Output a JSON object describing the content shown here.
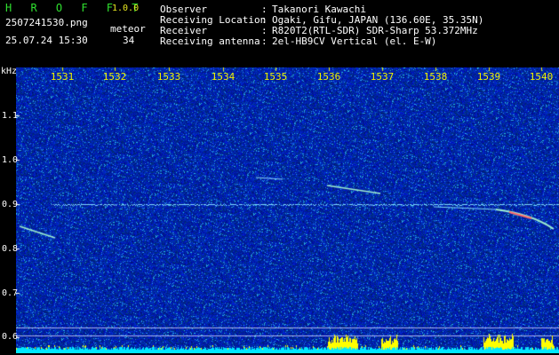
{
  "header": {
    "app_title": "H R O F F T",
    "version": "1.0.0",
    "filename": "2507241530.png",
    "datetime": "25.07.24 15:30",
    "meteor_label": "meteor",
    "meteor_count": "34",
    "info_rows": [
      {
        "key": "Observer",
        "sep": ":",
        "value": "Takanori Kawachi"
      },
      {
        "key": "Receiving Location",
        "sep": ":",
        "value": "Ogaki, Gifu, JAPAN (136.60E, 35.35N)"
      },
      {
        "key": "Receiver",
        "sep": ":",
        "value": "R820T2(RTL-SDR) SDR-Sharp 53.372MHz"
      },
      {
        "key": "Receiving antenna",
        "sep": ":",
        "value": "2el-HB9CV Vertical (el. E-W)"
      }
    ]
  },
  "spectrogram": {
    "y_unit": "kHz",
    "y_ticks": [
      "1.1",
      "1.0",
      "0.9",
      "0.8",
      "0.7",
      "0.6"
    ],
    "x_ticks": [
      "1531",
      "1532",
      "1533",
      "1534",
      "1535",
      "1536",
      "1537",
      "1538",
      "1539",
      "1540"
    ],
    "colors": {
      "background": "#0a1a8c",
      "tick": "#f0f000",
      "carrier": "#7fd8ff",
      "echo": "#9ff0d0",
      "echo_hot": "#ff6a6a",
      "signal_bar": "#00e8ff",
      "signal_peak": "#ffff00"
    }
  }
}
